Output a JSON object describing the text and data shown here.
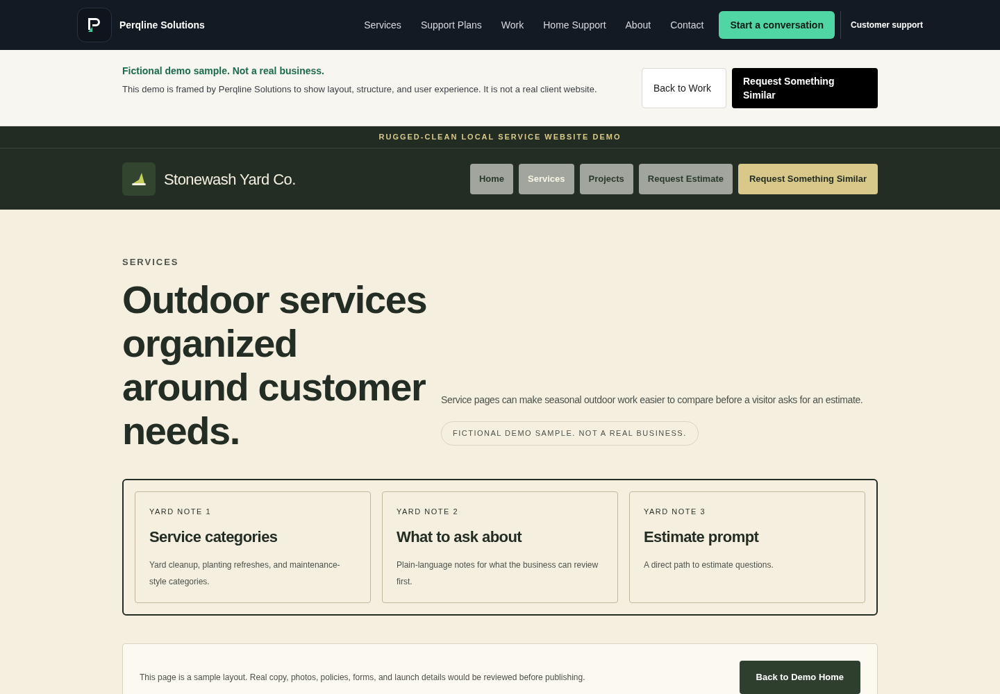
{
  "site_header": {
    "brand": "Perqline Solutions",
    "nav": [
      {
        "label": "Services"
      },
      {
        "label": "Support Plans"
      },
      {
        "label": "Work"
      },
      {
        "label": "Home Support"
      },
      {
        "label": "About"
      },
      {
        "label": "Contact"
      }
    ],
    "cta": "Start a conversation",
    "support_link": "Customer support"
  },
  "notice": {
    "title": "Fictional demo sample. Not a real business.",
    "text": "This demo is framed by Perqline Solutions to show layout, structure, and user experience. It is not a real client website.",
    "back_button": "Back to Work",
    "request_button": "Request Something Similar"
  },
  "demo_strip": "RUGGED-CLEAN LOCAL SERVICE WEBSITE DEMO",
  "demo_header": {
    "brand": "Stonewash Yard Co.",
    "nav": [
      {
        "label": "Home",
        "selected": false
      },
      {
        "label": "Services",
        "selected": true
      },
      {
        "label": "Projects",
        "selected": false
      },
      {
        "label": "Request Estimate",
        "selected": false
      }
    ],
    "cta": "Request Something Similar"
  },
  "hero": {
    "eyebrow": "SERVICES",
    "heading": "Outdoor services organized around customer needs.",
    "text": "Service pages can make seasonal outdoor work easier to compare before a visitor asks for an estimate.",
    "pill": "FICTIONAL DEMO SAMPLE. NOT A REAL BUSINESS."
  },
  "notes": [
    {
      "label": "YARD NOTE 1",
      "title": "Service categories",
      "text": "Yard cleanup, planting refreshes, and maintenance-style categories."
    },
    {
      "label": "YARD NOTE 2",
      "title": "What to ask about",
      "text": "Plain-language notes for what the business can review first."
    },
    {
      "label": "YARD NOTE 3",
      "title": "Estimate prompt",
      "text": "A direct path to estimate questions."
    }
  ],
  "footer_card": {
    "text": "This page is a sample layout. Real copy, photos, policies, forms, and launch details would be reviewed before publishing.",
    "button": "Back to Demo Home"
  }
}
